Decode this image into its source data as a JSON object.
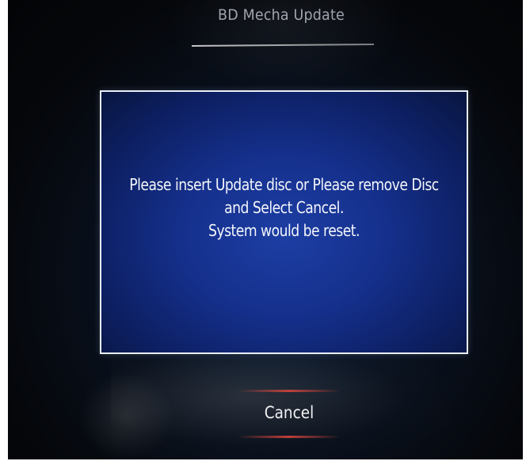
{
  "screen": {
    "title": "BD Mecha Update"
  },
  "dialog": {
    "message_lines": [
      "Please insert Update disc or Please remove Disc",
      "and Select Cancel.",
      "System would be reset."
    ]
  },
  "actions": {
    "cancel_label": "Cancel"
  },
  "colors": {
    "dialog_background": "#15308c",
    "dialog_border": "#e8eef8",
    "text": "#f4f6fb",
    "button_accent": "#dc463c"
  }
}
